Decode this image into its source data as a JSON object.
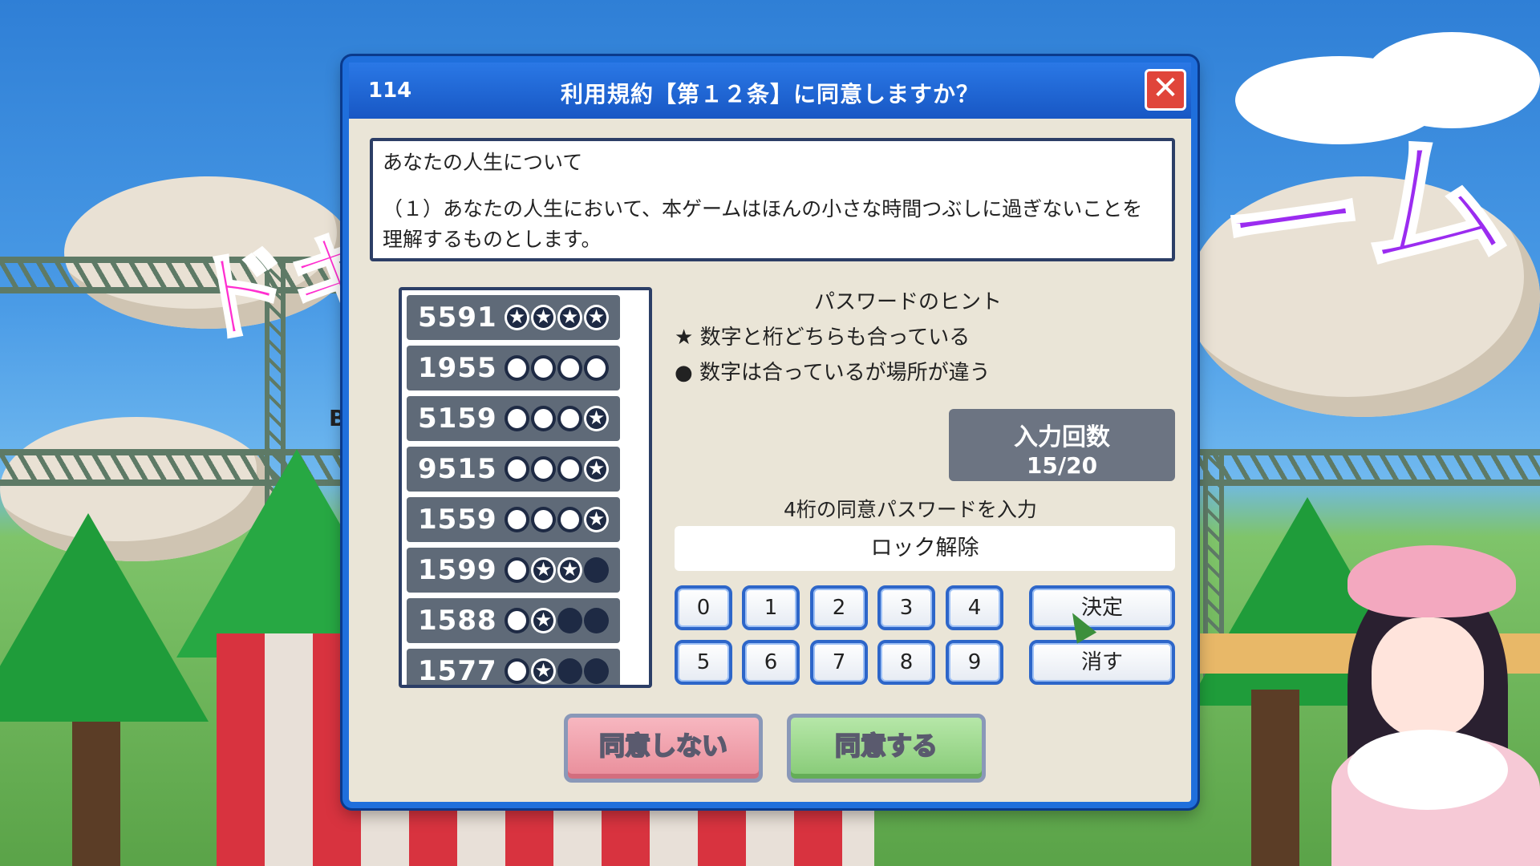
{
  "dialog": {
    "number": "114",
    "title": "利用規約【第１２条】に同意しますか？",
    "close_symbol": "✕"
  },
  "terms": {
    "heading": "あなたの人生について",
    "body": "（１）あなたの人生において、本ゲームはほんの小さな時間つぶしに過ぎないことを理解するものとします。"
  },
  "history": [
    {
      "code": "5591",
      "marks": [
        "star",
        "star",
        "star",
        "star"
      ]
    },
    {
      "code": "1955",
      "marks": [
        "circle",
        "circle",
        "circle",
        "circle"
      ]
    },
    {
      "code": "5159",
      "marks": [
        "circle",
        "circle",
        "circle",
        "star"
      ]
    },
    {
      "code": "9515",
      "marks": [
        "circle",
        "circle",
        "circle",
        "star"
      ]
    },
    {
      "code": "1559",
      "marks": [
        "circle",
        "circle",
        "circle",
        "star"
      ]
    },
    {
      "code": "1599",
      "marks": [
        "circle",
        "star",
        "star",
        "dot"
      ]
    },
    {
      "code": "1588",
      "marks": [
        "circle",
        "star",
        "dot",
        "dot"
      ]
    },
    {
      "code": "1577",
      "marks": [
        "circle",
        "star",
        "dot",
        "dot"
      ]
    }
  ],
  "hint": {
    "title": "パスワードのヒント",
    "star_line": "★ 数字と桁どちらも合っている",
    "circle_line": "● 数字は合っているが場所が違う"
  },
  "attempts": {
    "label": "入力回数",
    "value": "15/20"
  },
  "password": {
    "label": "4桁の同意パスワードを入力",
    "value": "ロック解除"
  },
  "keypad": {
    "digits_row1": [
      "0",
      "1",
      "2",
      "3",
      "4"
    ],
    "digits_row2": [
      "5",
      "6",
      "7",
      "8",
      "9"
    ],
    "confirm": "決定",
    "erase": "消す"
  },
  "actions": {
    "disagree": "同意しない",
    "agree": "同意する"
  },
  "scene": {
    "sign_left": "ドキ",
    "sign_right": "ーム",
    "sign_small": "B"
  },
  "colors": {
    "dialog_border": "#1f6fdc",
    "close_button": "#e0453a",
    "history_row": "#5f6a78",
    "disagree_button": "#e98d9a",
    "agree_button": "#86ca76"
  }
}
